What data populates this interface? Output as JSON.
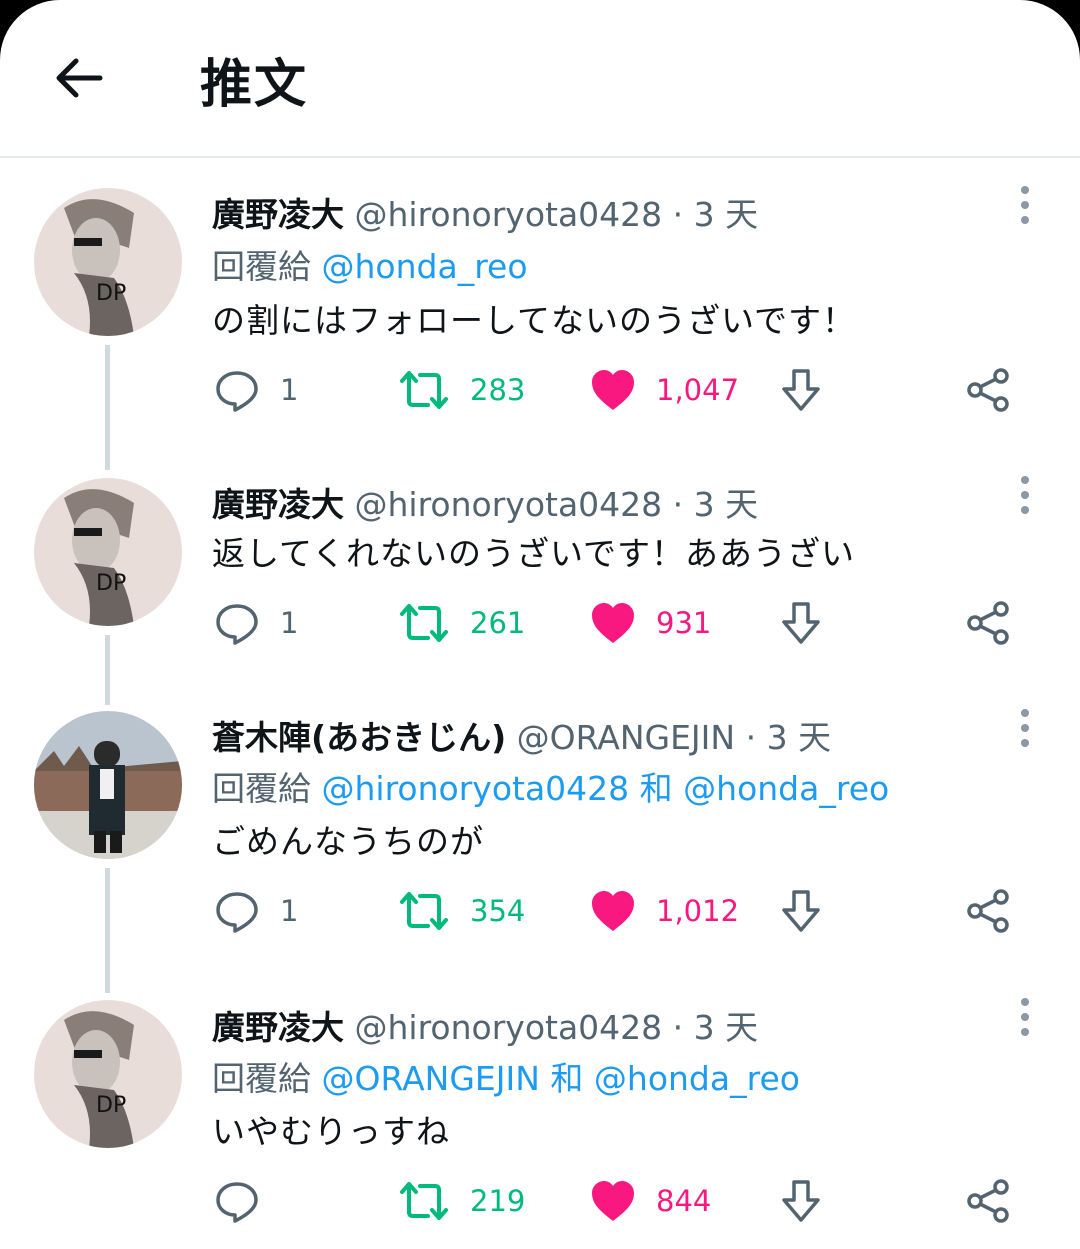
{
  "header": {
    "title": "推文"
  },
  "tweets": [
    {
      "name": "廣野凌大",
      "handle": "@hironoryota0428",
      "sep": "·",
      "time": "3 天",
      "reply_prefix": "回覆給",
      "mentions": [
        "@honda_reo"
      ],
      "joiner": "",
      "text": "の割にはフォローしてないのうざいです！",
      "replies": "1",
      "retweets": "283",
      "likes": "1,047"
    },
    {
      "name": "廣野凌大",
      "handle": "@hironoryota0428",
      "sep": "·",
      "time": "3 天",
      "text": "返してくれないのうざいです！ああうざい",
      "replies": "1",
      "retweets": "261",
      "likes": "931"
    },
    {
      "name": "蒼木陣(あおきじん)",
      "handle": "@ORANGEJIN",
      "sep": "·",
      "time": "3 天",
      "reply_prefix": "回覆給",
      "mentions": [
        "@hironoryota0428",
        "@honda_reo"
      ],
      "joiner": "和",
      "text": "ごめんなうちのが",
      "replies": "1",
      "retweets": "354",
      "likes": "1,012"
    },
    {
      "name": "廣野凌大",
      "handle": "@hironoryota0428",
      "sep": "·",
      "time": "3 天",
      "reply_prefix": "回覆給",
      "mentions": [
        "@ORANGEJIN",
        "@honda_reo"
      ],
      "joiner": "和",
      "text": "いやむりっすね",
      "replies": "",
      "retweets": "219",
      "likes": "844"
    }
  ],
  "colors": {
    "retweet": "#00ba7c",
    "like": "#f91880",
    "mention": "#1d9bf0",
    "muted": "#536471"
  },
  "icons": [
    "back-arrow-icon",
    "more-icon",
    "reply-icon",
    "retweet-icon",
    "heart-icon",
    "bookmark-download-icon",
    "share-icon"
  ]
}
